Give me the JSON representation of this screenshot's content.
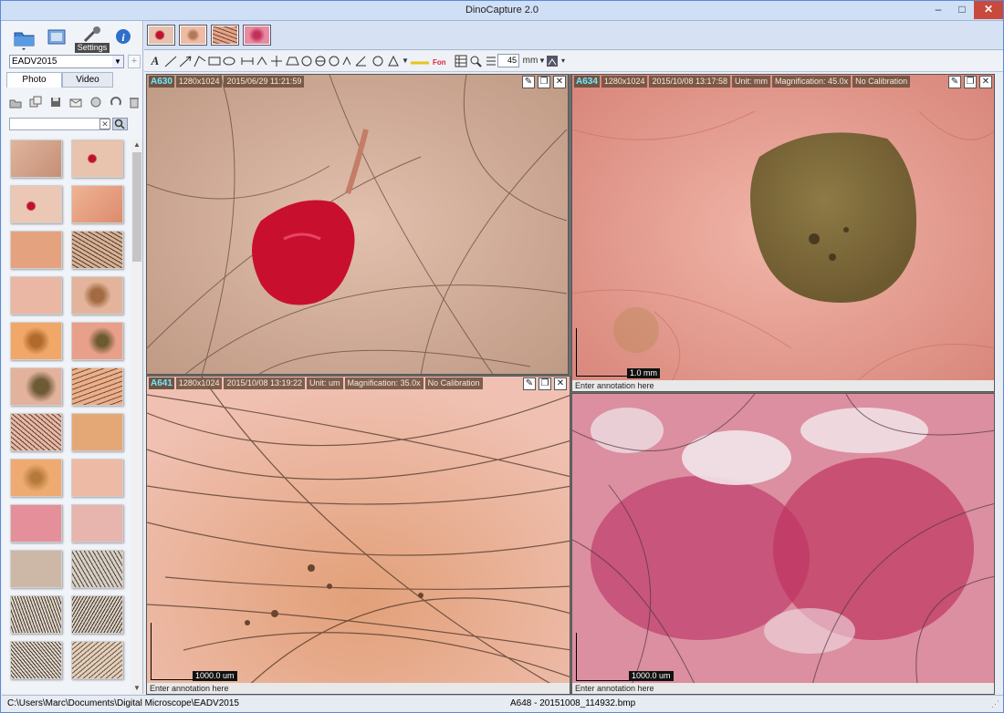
{
  "window": {
    "title": "DinoCapture 2.0",
    "minimize": "–",
    "maximize": "□",
    "close": "✕"
  },
  "main_toolbar": {
    "settings_label": "Settings"
  },
  "project": {
    "selected": "EADV2015",
    "add": "+"
  },
  "tabs": {
    "photo": "Photo",
    "video": "Video"
  },
  "search": {
    "placeholder": "",
    "clear": "✕"
  },
  "draw_toolbar": {
    "line_width": "45",
    "unit": "mm"
  },
  "panes": [
    {
      "id": "A630",
      "resolution": "1280x1024",
      "datetime": "2015/06/29 11:21:59"
    },
    {
      "id": "A634",
      "resolution": "1280x1024",
      "datetime": "2015/10/08 13:17:58",
      "unit": "Unit: mm",
      "magnification": "Magnification: 45.0x",
      "calibration": "No Calibration",
      "scale": "1.0 mm",
      "annotation": "Enter annotation here"
    },
    {
      "id": "A641",
      "resolution": "1280x1024",
      "datetime": "2015/10/08 13:19:22",
      "unit": "Unit: um",
      "magnification": "Magnification: 35.0x",
      "calibration": "No Calibration",
      "scale": "1000.0 um",
      "annotation": "Enter annotation here"
    },
    {
      "scale": "1000.0 um",
      "annotation": "Enter annotation here"
    }
  ],
  "status": {
    "path": "C:\\Users\\Marc\\Documents\\Digital Microscope\\EADV2015",
    "file": "A648 - 20151008_114932.bmp"
  },
  "colors": {
    "accent": "#6ee8ff",
    "skin": "#d9a48c",
    "titlebar": "#cfdff5"
  },
  "icons": [
    "folder-icon",
    "gallery-icon",
    "settings-icon",
    "info-icon",
    "search-icon",
    "text-icon",
    "line-icon",
    "arrow-icon",
    "rectangle-icon",
    "ellipse-icon",
    "wrench-icon",
    "restore-icon",
    "close-icon"
  ]
}
